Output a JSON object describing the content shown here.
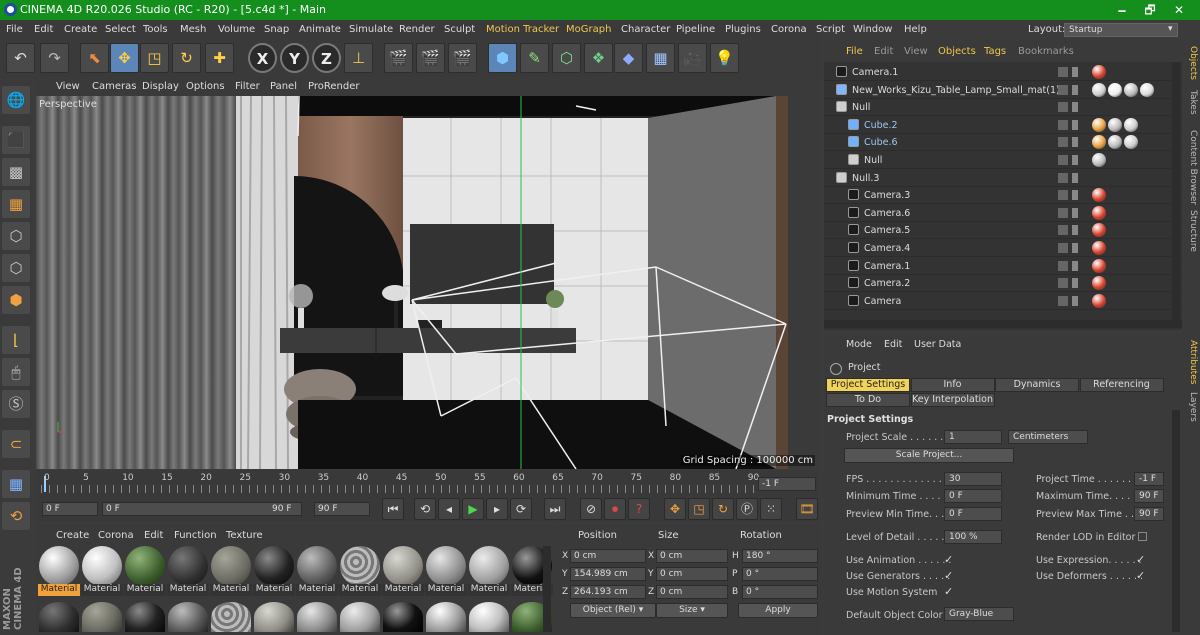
{
  "window": {
    "title": "CINEMA 4D R20.026 Studio (RC - R20) - [5.c4d *] - Main",
    "minimize": "🗕",
    "restore": "🗗",
    "close": "✕"
  },
  "menu": [
    "File",
    "Edit",
    "Create",
    "Select",
    "Tools",
    "Mesh",
    "Volume",
    "Snap",
    "Animate",
    "Simulate",
    "Render",
    "Sculpt",
    "Motion Tracker",
    "MoGraph",
    "Character",
    "Pipeline",
    "Plugins",
    "Corona",
    "Script",
    "Window",
    "Help"
  ],
  "layout": {
    "label": "Layout:",
    "value": "Startup"
  },
  "viewport": {
    "menu": [
      "View",
      "Cameras",
      "Display",
      "Options",
      "Filter",
      "Panel",
      "ProRender"
    ],
    "label": "Perspective",
    "grid_spacing": "Grid Spacing : 100000 cm"
  },
  "timeline": {
    "ticks": [
      "0",
      "5",
      "10",
      "15",
      "20",
      "25",
      "30",
      "35",
      "40",
      "45",
      "50",
      "55",
      "60",
      "65",
      "70",
      "75",
      "80",
      "85",
      "90"
    ],
    "current_frame": "-1 F",
    "start": "0 F",
    "min": "0 F",
    "max": "90 F",
    "end": "90 F"
  },
  "materials": {
    "menu": [
      "Create",
      "Corona",
      "Edit",
      "Function",
      "Texture"
    ],
    "items": [
      "Material",
      "Material",
      "Material",
      "Material",
      "Material",
      "Material",
      "Material",
      "Material",
      "Material",
      "Material",
      "Material",
      "Material"
    ]
  },
  "coords": {
    "headers": [
      "Position",
      "Size",
      "Rotation"
    ],
    "rows": [
      {
        "axis": "X",
        "pos": "0 cm",
        "saxis": "X",
        "size": "0 cm",
        "raxis": "H",
        "rot": "180 °"
      },
      {
        "axis": "Y",
        "pos": "154.989 cm",
        "saxis": "Y",
        "size": "0 cm",
        "raxis": "P",
        "rot": "0 °"
      },
      {
        "axis": "Z",
        "pos": "264.193 cm",
        "saxis": "Z",
        "size": "0 cm",
        "raxis": "B",
        "rot": "0 °"
      }
    ],
    "mode": "Object (Rel)",
    "size_mode": "Size",
    "apply": "Apply"
  },
  "objects": {
    "menu": [
      "File",
      "Edit",
      "View",
      "Objects",
      "Tags",
      "Bookmarks"
    ],
    "rows": [
      {
        "name": "Camera.1",
        "indent": 0,
        "type": "camera"
      },
      {
        "name": "New_Works_Kizu_Table_Lamp_Small_mat(1)",
        "indent": 0,
        "type": "mesh"
      },
      {
        "name": "Null",
        "indent": 0,
        "type": "null"
      },
      {
        "name": "Cube.2",
        "indent": 1,
        "type": "cube"
      },
      {
        "name": "Cube.6",
        "indent": 1,
        "type": "cube"
      },
      {
        "name": "Null",
        "indent": 1,
        "type": "null"
      },
      {
        "name": "Null.3",
        "indent": 0,
        "type": "null"
      },
      {
        "name": "Camera.3",
        "indent": 1,
        "type": "camera"
      },
      {
        "name": "Camera.6",
        "indent": 1,
        "type": "camera"
      },
      {
        "name": "Camera.5",
        "indent": 1,
        "type": "camera"
      },
      {
        "name": "Camera.4",
        "indent": 1,
        "type": "camera"
      },
      {
        "name": "Camera.1",
        "indent": 1,
        "type": "camera"
      },
      {
        "name": "Camera.2",
        "indent": 1,
        "type": "camera"
      },
      {
        "name": "Camera",
        "indent": 1,
        "type": "camera"
      }
    ]
  },
  "sidetabs": [
    "Objects",
    "Takes",
    "Content Browser",
    "Structure",
    "Attributes",
    "Layers"
  ],
  "attributes": {
    "menu": [
      "Mode",
      "Edit",
      "User Data"
    ],
    "object": "Project",
    "tabs_row1": [
      "Project Settings",
      "Info",
      "Dynamics",
      "Referencing"
    ],
    "tabs_row2": [
      "To Do",
      "Key Interpolation"
    ],
    "section": "Project Settings",
    "project_scale_label": "Project Scale . . . . . . .",
    "project_scale_value": "1",
    "project_scale_unit": "Centimeters",
    "scale_project": "Scale Project...",
    "fps_label": "FPS . . . . . . . . . . . . . . .",
    "fps": "30",
    "project_time_label": "Project Time . . . . . . .",
    "project_time": "-1 F",
    "min_time_label": "Minimum Time . . . . . .",
    "min_time": "0 F",
    "max_time_label": "Maximum Time. . . . . .",
    "max_time": "90 F",
    "prev_min_label": "Preview Min Time. . . .",
    "prev_min": "0 F",
    "prev_max_label": "Preview Max Time . . .",
    "prev_max": "90 F",
    "lod_label": "Level of Detail . . . . .",
    "lod": "100 %",
    "render_lod_label": "Render LOD in Editor",
    "use_anim_label": "Use Animation . . . . . .",
    "use_expr_label": "Use Expression. . . . . .",
    "use_gen_label": "Use Generators . . . . .",
    "use_def_label": "Use Deformers . . . . . .",
    "use_motion_label": "Use Motion System",
    "def_color_label": "Default Object Color",
    "def_color": "Gray-Blue",
    "check": "✓"
  },
  "brand": "MAXON CINEMA 4D",
  "colors": {
    "titlebar": "#148f1e",
    "accent": "#f2d35a",
    "selection": "#5c86b8"
  }
}
